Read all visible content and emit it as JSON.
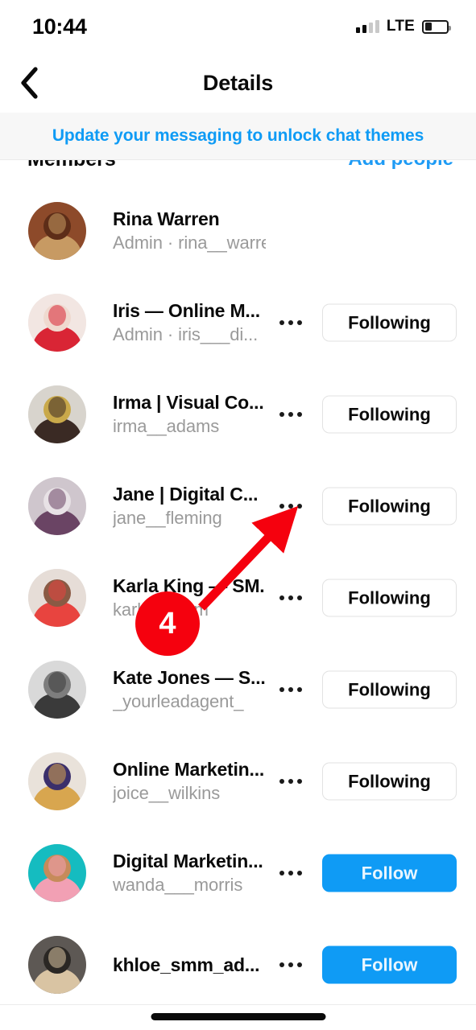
{
  "status_bar": {
    "time": "10:44",
    "network_label": "LTE",
    "signal_bars_filled": 2,
    "signal_bars_total": 4,
    "battery_percent": 34
  },
  "nav": {
    "back_icon": "chevron-left-icon",
    "title": "Details"
  },
  "banner": {
    "text": "Update your messaging to unlock chat themes",
    "link_color": "#0f9bf5",
    "background": "#f7f7f7"
  },
  "section": {
    "title": "Members",
    "action_label": "Add people"
  },
  "annotation": {
    "badge_number": "4",
    "badge_color": "#f5010e",
    "arrow_color": "#f5010e",
    "points_to": "more-options-icon on Jane | Digital C... row"
  },
  "colors": {
    "follow_blue": "#0f9bf5",
    "text_primary": "#0a0a0a",
    "text_secondary": "#9a9a9a",
    "border": "#e2e2e2"
  },
  "members": [
    {
      "name": "Rina Warren",
      "subtitle": "Admin · rina__warren",
      "has_more": false,
      "button": null,
      "avatar": "woman-in-straw-hat"
    },
    {
      "name": "Iris — Online M...",
      "subtitle": "Admin · iris___di...",
      "has_more": true,
      "button": {
        "label": "Following",
        "style": "following"
      },
      "avatar": "woman-in-red-dress"
    },
    {
      "name": "Irma | Visual Co...",
      "subtitle": "irma__adams",
      "has_more": true,
      "button": {
        "label": "Following",
        "style": "following"
      },
      "avatar": "woman-with-gold-necklace"
    },
    {
      "name": "Jane | Digital C...",
      "subtitle": "jane__fleming",
      "has_more": true,
      "button": {
        "label": "Following",
        "style": "following"
      },
      "avatar": "woman-in-purple-hat"
    },
    {
      "name": "Karla King — SM...",
      "subtitle": "karla__smm",
      "has_more": true,
      "button": {
        "label": "Following",
        "style": "following"
      },
      "avatar": "woman-in-red-top"
    },
    {
      "name": "Kate Jones — S...",
      "subtitle": "_yourleadagent_",
      "has_more": true,
      "button": {
        "label": "Following",
        "style": "following"
      },
      "avatar": "black-and-white-cityscape"
    },
    {
      "name": "Online Marketin...",
      "subtitle": "joice__wilkins",
      "has_more": true,
      "button": {
        "label": "Following",
        "style": "following"
      },
      "avatar": "woman-with-long-blonde-hair"
    },
    {
      "name": "Digital Marketin...",
      "subtitle": "wanda___morris",
      "has_more": true,
      "button": {
        "label": "Follow",
        "style": "follow"
      },
      "avatar": "woman-with-pink-float-teal-background"
    },
    {
      "name": "khloe_smm_ad...",
      "subtitle": "",
      "has_more": true,
      "button": {
        "label": "Follow",
        "style": "follow"
      },
      "avatar": "woman-with-blonde-hair-dark-background"
    }
  ]
}
